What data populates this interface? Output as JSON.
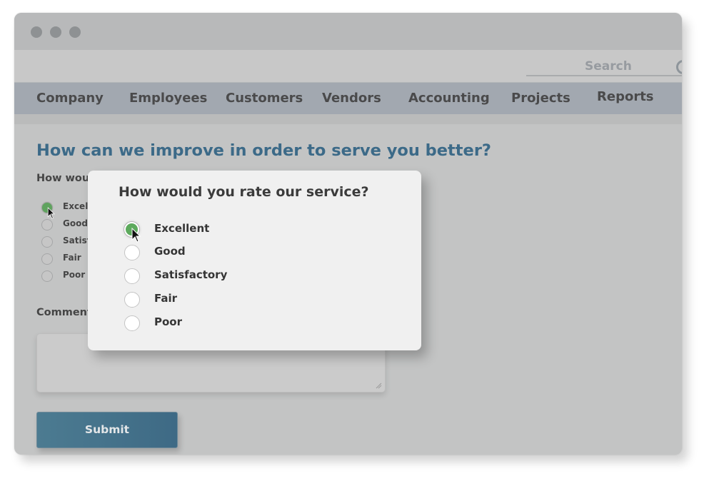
{
  "window": {
    "traffic_lights": [
      "close",
      "minimize",
      "maximize"
    ]
  },
  "toolbar": {
    "search_placeholder": "Search",
    "search_icon": "search-icon"
  },
  "nav": {
    "items": [
      {
        "label": "Company"
      },
      {
        "label": "Employees"
      },
      {
        "label": "Customers"
      },
      {
        "label": "Vendors"
      },
      {
        "label": "Accounting"
      },
      {
        "label": "Projects"
      },
      {
        "label": "Reports"
      }
    ]
  },
  "form": {
    "heading": "How can we improve in order to serve you better?",
    "question_truncated": "How woul",
    "options_truncated": [
      "Excelle",
      "Good",
      "Satisfa",
      "Fair",
      "Poor"
    ],
    "selected_index": 0,
    "comment_label_truncated": "Comment",
    "comment_value": "",
    "submit_label": "Submit"
  },
  "popup": {
    "title": "How would you rate our service?",
    "options": [
      "Excellent",
      "Good",
      "Satisfactory",
      "Fair",
      "Poor"
    ],
    "selected_index": 0
  },
  "colors": {
    "accent_heading": "#3c6a88",
    "submit_button": "#446f89",
    "selected_radio": "#5daa5d",
    "nav_bar": "#a2a8b0"
  }
}
